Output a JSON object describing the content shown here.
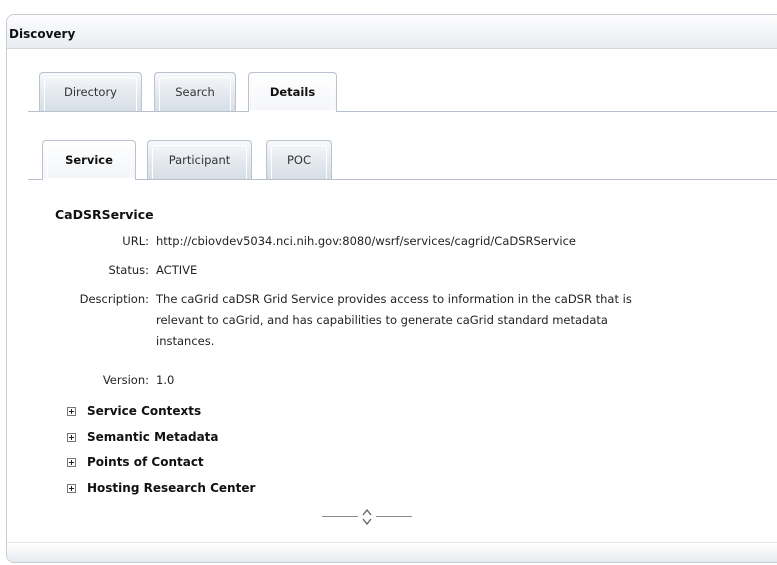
{
  "panel": {
    "title": "Discovery"
  },
  "main_tabs": [
    {
      "label": "Directory",
      "active": false
    },
    {
      "label": "Search",
      "active": false
    },
    {
      "label": "Details",
      "active": true
    }
  ],
  "sub_tabs": [
    {
      "label": "Service",
      "active": true
    },
    {
      "label": "Participant",
      "active": false
    },
    {
      "label": "POC",
      "active": false
    }
  ],
  "service": {
    "name": "CaDSRService",
    "url_label": "URL:",
    "url": "http://cbiovdev5034.nci.nih.gov:8080/wsrf/services/cagrid/CaDSRService",
    "status_label": "Status:",
    "status": "ACTIVE",
    "description_label": "Description:",
    "description_lines": [
      "The caGrid caDSR Grid Service provides access to information in the caDSR that is",
      "relevant to caGrid, and has capabilities to generate caGrid standard metadata",
      "instances."
    ],
    "version_label": "Version:",
    "version": "1.0"
  },
  "sections": [
    {
      "label": "Service Contexts",
      "icon": "expand-plus-icon"
    },
    {
      "label": "Semantic Metadata",
      "icon": "expand-plus-icon"
    },
    {
      "label": "Points of Contact",
      "icon": "expand-plus-icon"
    },
    {
      "label": "Hosting Research Center",
      "icon": "expand-plus-icon"
    }
  ]
}
